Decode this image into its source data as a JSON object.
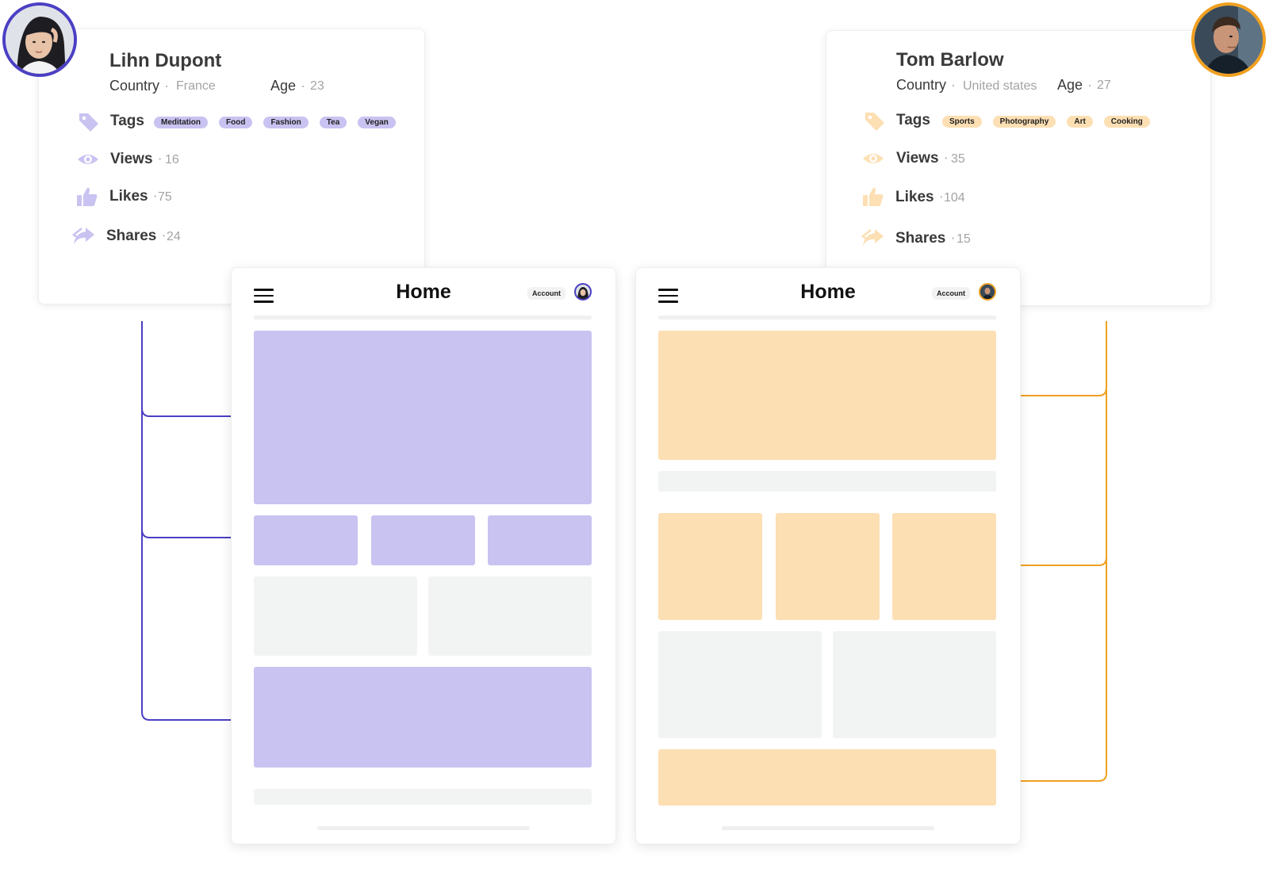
{
  "colors": {
    "purple": "#4b3fc4",
    "purple_light": "#c9c3f1",
    "orange": "#f0a020",
    "orange_light": "#fddfb4",
    "placeholder_grey": "#f2f3f3"
  },
  "profiles": [
    {
      "name": "Lihn Dupont",
      "country_label": "Country",
      "country": "France",
      "age_label": "Age",
      "age": "23",
      "tags_label": "Tags",
      "tags": [
        "Meditation",
        "Food",
        "Fashion",
        "Tea",
        "Vegan"
      ],
      "views_label": "Views",
      "views": "16",
      "likes_label": "Likes",
      "likes": "75",
      "shares_label": "Shares",
      "shares": "24",
      "avatar_icon": "woman-avatar-icon",
      "accent": "#4b3fc4"
    },
    {
      "name": "Tom Barlow",
      "country_label": "Country",
      "country": "United states",
      "age_label": "Age",
      "age": "27",
      "tags_label": "Tags",
      "tags": [
        "Sports",
        "Photography",
        "Art",
        "Cooking"
      ],
      "views_label": "Views",
      "views": "35",
      "likes_label": "Likes",
      "likes": "104",
      "shares_label": "Shares",
      "shares": "15",
      "avatar_icon": "man-avatar-icon",
      "accent": "#f0a020"
    }
  ],
  "phones": [
    {
      "title": "Home",
      "account_label": "Account",
      "menu_icon": "hamburger-menu-icon"
    },
    {
      "title": "Home",
      "account_label": "Account",
      "menu_icon": "hamburger-menu-icon"
    }
  ]
}
